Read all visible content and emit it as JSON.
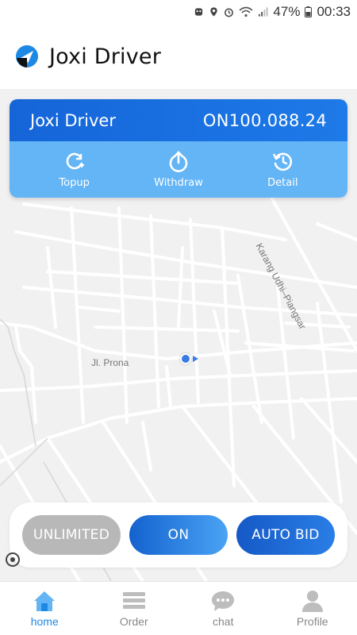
{
  "status_bar": {
    "battery": "47%",
    "time": "00:33"
  },
  "header": {
    "title": "Joxi Driver"
  },
  "wallet": {
    "name": "Joxi Driver",
    "balance": "ON100.088.24",
    "actions": [
      {
        "label": "Topup",
        "icon": "topup-icon"
      },
      {
        "label": "Withdraw",
        "icon": "withdraw-icon"
      },
      {
        "label": "Detail",
        "icon": "history-icon"
      }
    ]
  },
  "map": {
    "street_1": "Jl. Prona",
    "street_2": "Karang Udhi–Piangsar"
  },
  "controls": {
    "unlimited": "UNLIMITED",
    "on": "ON",
    "auto_bid": "AUTO BID"
  },
  "nav": [
    {
      "label": "home",
      "icon": "home-icon",
      "active": true
    },
    {
      "label": "Order",
      "icon": "list-icon",
      "active": false
    },
    {
      "label": "chat",
      "icon": "chat-icon",
      "active": false
    },
    {
      "label": "Profile",
      "icon": "person-icon",
      "active": false
    }
  ],
  "colors": {
    "primary": "#1565d8",
    "card_light": "#64b5f6",
    "active_nav": "#1e88e5",
    "inactive_gray": "#b8b8b8"
  }
}
